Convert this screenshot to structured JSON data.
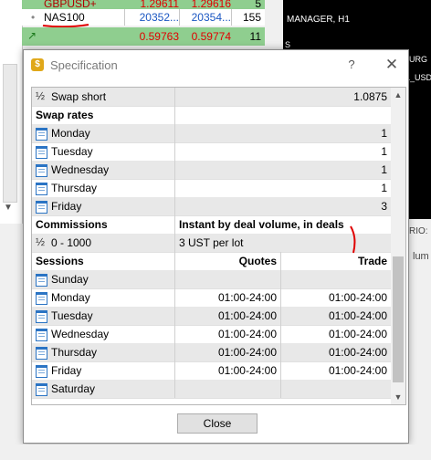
{
  "market_watch": {
    "rows": [
      {
        "symbol": "GBPUSD+",
        "bid": "1.29611",
        "ask": "1.29616",
        "spread": "5"
      },
      {
        "symbol": "NAS100",
        "bid": "20352...",
        "ask": "20354...",
        "spread": "155"
      },
      {
        "symbol": "",
        "bid": "0.59763",
        "ask": "0.59774",
        "spread": "11"
      }
    ]
  },
  "chart": {
    "title": "MANAGER, H1",
    "side_labels": [
      "S",
      "URG",
      "L_USD",
      "RIO:",
      "lum"
    ]
  },
  "dialog": {
    "title": "Specification",
    "help": "?",
    "close_glyph": "✕",
    "close_button": "Close",
    "rows": [
      {
        "icon": "half",
        "label": "Swap short",
        "value": "1.0875"
      },
      {
        "section": "Swap rates"
      },
      {
        "icon": "calendar",
        "label": "Monday",
        "value": "1"
      },
      {
        "icon": "calendar",
        "label": "Tuesday",
        "value": "1"
      },
      {
        "icon": "calendar",
        "label": "Wednesday",
        "value": "1"
      },
      {
        "icon": "calendar",
        "label": "Thursday",
        "value": "1"
      },
      {
        "icon": "calendar",
        "label": "Friday",
        "value": "3"
      },
      {
        "section": "Commissions",
        "value": "Instant by deal volume, in deals"
      },
      {
        "icon": "half",
        "label": "0 - 1000",
        "value": "3 UST per lot"
      },
      {
        "section": "Sessions",
        "col2": "Quotes",
        "col3": "Trade"
      },
      {
        "icon": "calendar",
        "label": "Sunday",
        "col2": "",
        "col3": ""
      },
      {
        "icon": "calendar",
        "label": "Monday",
        "col2": "01:00-24:00",
        "col3": "01:00-24:00"
      },
      {
        "icon": "calendar",
        "label": "Tuesday",
        "col2": "01:00-24:00",
        "col3": "01:00-24:00"
      },
      {
        "icon": "calendar",
        "label": "Wednesday",
        "col2": "01:00-24:00",
        "col3": "01:00-24:00"
      },
      {
        "icon": "calendar",
        "label": "Thursday",
        "col2": "01:00-24:00",
        "col3": "01:00-24:00"
      },
      {
        "icon": "calendar",
        "label": "Friday",
        "col2": "01:00-24:00",
        "col3": "01:00-24:00"
      },
      {
        "icon": "calendar",
        "label": "Saturday",
        "col2": "",
        "col3": ""
      }
    ]
  },
  "colors": {
    "bid_red": "#e00000",
    "symbol_blue": "#1a56c2",
    "row_green": "#8fce8f",
    "annotation_red": "#e00000",
    "calendar_blue": "#2b74c4"
  }
}
